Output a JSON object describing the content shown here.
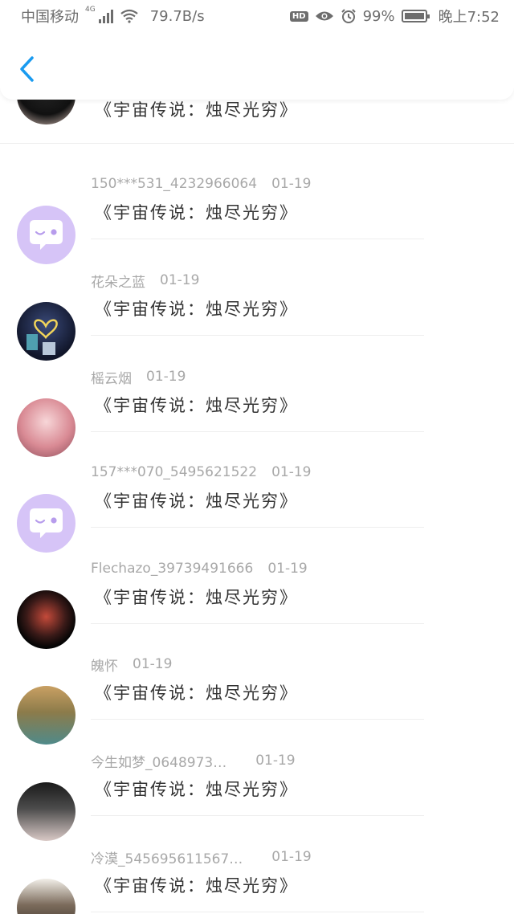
{
  "status_bar": {
    "carrier": "中国移动",
    "network": "4G",
    "speed": "79.7B/s",
    "hd": "HD",
    "battery": "99%",
    "time": "晚上7:52",
    "battery_level": 0.99
  },
  "header": {
    "back_icon": "chevron-left-icon",
    "accent_color": "#1a9bf0"
  },
  "top_partial_message": "《宇宙传说：烛尽光穷》",
  "comments": [
    {
      "name": "150***531_4232966064",
      "date": "01-19",
      "text": "《宇宙传说：烛尽光穷》",
      "avatar": "chat-bubble-avatar"
    },
    {
      "name": "花朵之蓝",
      "date": "01-19",
      "text": "《宇宙传说：烛尽光穷》",
      "avatar": "photo-avatar"
    },
    {
      "name": "榣云烟",
      "date": "01-19",
      "text": "《宇宙传说：烛尽光穷》",
      "avatar": "photo-avatar"
    },
    {
      "name": "157***070_5495621522",
      "date": "01-19",
      "text": "《宇宙传说：烛尽光穷》",
      "avatar": "chat-bubble-avatar"
    },
    {
      "name": "Flechazo_39739491666",
      "date": "01-19",
      "text": "《宇宙传说：烛尽光穷》",
      "avatar": "photo-avatar"
    },
    {
      "name": "魄怀",
      "date": "01-19",
      "text": "《宇宙传说：烛尽光穷》",
      "avatar": "photo-avatar"
    },
    {
      "name": "今生如梦_0648973…",
      "date": "01-19",
      "text": "《宇宙传说：烛尽光穷》",
      "avatar": "photo-avatar"
    },
    {
      "name": "冷漠_545695611567…",
      "date": "01-19",
      "text": "《宇宙传说：烛尽光穷》",
      "avatar": "photo-avatar"
    }
  ]
}
